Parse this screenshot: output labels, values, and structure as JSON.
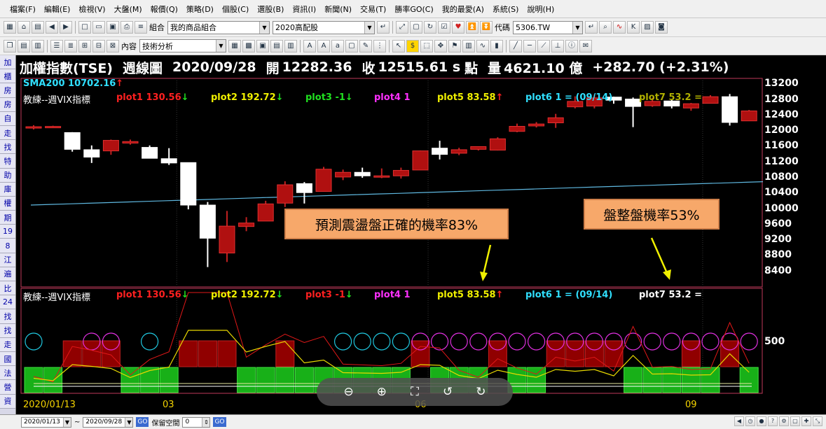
{
  "menu": [
    "檔案(F)",
    "編輯(E)",
    "檢視(V)",
    "大盤(M)",
    "報價(Q)",
    "策略(D)",
    "個股(C)",
    "選股(B)",
    "資訊(I)",
    "新聞(N)",
    "交易(T)",
    "勝率GO(C)",
    "我的最愛(A)",
    "系統(S)",
    "說明(H)"
  ],
  "toolbar1": {
    "group_label": "組合",
    "portfolio": "我的商品組合",
    "strategy": "2020高配股",
    "code_label": "代碼",
    "code_value": "5306.TW"
  },
  "toolbar2": {
    "content_label": "內容",
    "content_value": "技術分析"
  },
  "side_tabs": [
    "加",
    "櫃",
    "房",
    "房",
    "自",
    "走",
    "找",
    "特",
    "助",
    "庫",
    "權",
    "期",
    "19",
    "8",
    "江",
    "遍",
    "比",
    "24",
    "找",
    "找",
    "走",
    "國",
    "法",
    "營",
    "資"
  ],
  "title": {
    "name": "加權指數(TSE)",
    "period": "週線圖",
    "date": "2020/09/28",
    "open_label": "開",
    "open": "12282.36",
    "close_label": "收",
    "close": "12515.61 s",
    "unit": "點",
    "volume_label": "量",
    "volume": "4621.10 億",
    "change": "+282.70 (+2.31%)"
  },
  "main_panel": {
    "sma_label": "SMA200 10702.16",
    "sma_arrow": "↑",
    "indicator_name": "教練--週VIX指標",
    "plots": [
      {
        "label": "plot1 130.56",
        "arrow": "↓",
        "color": "#ff2020"
      },
      {
        "label": "plot2 192.72",
        "arrow": "↓",
        "color": "#f0f000"
      },
      {
        "label": "plot3 -1",
        "arrow": "↓",
        "color": "#20e020"
      },
      {
        "label": "plot4 1",
        "arrow": "",
        "color": "#ff30ff"
      },
      {
        "label": "plot5 83.58",
        "arrow": "↑",
        "color": "#f0f000"
      },
      {
        "label": "plot6 1 = (09/14)",
        "arrow": "",
        "color": "#30e0ff"
      },
      {
        "label": "plot7 53.2 =",
        "arrow": "",
        "color": "#b0b000"
      }
    ]
  },
  "sub_panel": {
    "indicator_name": "教練--週VIX指標",
    "plots": [
      {
        "label": "plot1 130.56",
        "arrow": "↓",
        "color": "#ff2020"
      },
      {
        "label": "plot2 192.72",
        "arrow": "↓",
        "color": "#f0f000"
      },
      {
        "label": "plot3 -1",
        "arrow": "↓",
        "color": "#ff2020"
      },
      {
        "label": "plot4 1",
        "arrow": "",
        "color": "#ff30ff"
      },
      {
        "label": "plot5 83.58",
        "arrow": "↑",
        "color": "#f0f000"
      },
      {
        "label": "plot6 1 = (09/14)",
        "arrow": "",
        "color": "#30e0ff"
      },
      {
        "label": "plot7 53.2 =",
        "arrow": "",
        "color": "#ffffff"
      }
    ],
    "y_label": "500"
  },
  "callouts": {
    "volatile": "預測震盪盤正確的機率83%",
    "consolidation": "盤整盤機率53%"
  },
  "statusbar": {
    "start_date": "2020/01/13",
    "end_date": "2020/09/28",
    "go_label": "GO",
    "reserve_label": "保留空間",
    "reserve_value": "0",
    "tilde": "~"
  },
  "chart_data": {
    "type": "candlestick",
    "y_ticks": [
      13200,
      12800,
      12400,
      12000,
      11600,
      11200,
      10800,
      10400,
      10000,
      9600,
      9200,
      8800,
      8400
    ],
    "ylim": [
      8000,
      13350
    ],
    "x_ticks": [
      "2020/01/13",
      "03",
      "06",
      "09"
    ],
    "candles": [
      {
        "o": 12090,
        "h": 12150,
        "l": 12040,
        "c": 12110
      },
      {
        "o": 12118,
        "h": 12135,
        "l": 12095,
        "c": 12118
      },
      {
        "o": 11960,
        "h": 11970,
        "l": 11470,
        "c": 11530
      },
      {
        "o": 11520,
        "h": 11630,
        "l": 11180,
        "c": 11330
      },
      {
        "o": 11490,
        "h": 11780,
        "l": 11390,
        "c": 11760
      },
      {
        "o": 11690,
        "h": 11780,
        "l": 11650,
        "c": 11730
      },
      {
        "o": 11580,
        "h": 11630,
        "l": 11300,
        "c": 11300
      },
      {
        "o": 11290,
        "h": 11560,
        "l": 11130,
        "c": 11180
      },
      {
        "o": 11190,
        "h": 11190,
        "l": 9990,
        "c": 10100
      },
      {
        "o": 10100,
        "h": 10180,
        "l": 8510,
        "c": 9250
      },
      {
        "o": 8870,
        "h": 9950,
        "l": 8640,
        "c": 9560
      },
      {
        "o": 9550,
        "h": 9790,
        "l": 9430,
        "c": 9640
      },
      {
        "o": 9690,
        "h": 10210,
        "l": 9690,
        "c": 10130
      },
      {
        "o": 10150,
        "h": 10710,
        "l": 10050,
        "c": 10620
      },
      {
        "o": 10650,
        "h": 10690,
        "l": 10140,
        "c": 10420
      },
      {
        "o": 10450,
        "h": 11080,
        "l": 10450,
        "c": 11020
      },
      {
        "o": 10820,
        "h": 11010,
        "l": 10740,
        "c": 10940
      },
      {
        "o": 10940,
        "h": 11060,
        "l": 10800,
        "c": 10850
      },
      {
        "o": 10820,
        "h": 11040,
        "l": 10790,
        "c": 10850
      },
      {
        "o": 10850,
        "h": 11060,
        "l": 10780,
        "c": 10990
      },
      {
        "o": 11000,
        "h": 11500,
        "l": 11000,
        "c": 11490
      },
      {
        "o": 11560,
        "h": 11750,
        "l": 11270,
        "c": 11400
      },
      {
        "o": 11430,
        "h": 11570,
        "l": 11380,
        "c": 11520
      },
      {
        "o": 11530,
        "h": 11600,
        "l": 11500,
        "c": 11600
      },
      {
        "o": 11510,
        "h": 11840,
        "l": 11500,
        "c": 11800
      },
      {
        "o": 11990,
        "h": 12190,
        "l": 11970,
        "c": 12120
      },
      {
        "o": 12130,
        "h": 12230,
        "l": 12090,
        "c": 12180
      },
      {
        "o": 12210,
        "h": 12440,
        "l": 12080,
        "c": 12340
      },
      {
        "o": 12620,
        "h": 12890,
        "l": 12580,
        "c": 12760
      },
      {
        "o": 12640,
        "h": 12940,
        "l": 12580,
        "c": 12850
      },
      {
        "o": 12870,
        "h": 12880,
        "l": 12700,
        "c": 12790
      },
      {
        "o": 12820,
        "h": 12860,
        "l": 12100,
        "c": 12630
      },
      {
        "o": 12650,
        "h": 12850,
        "l": 12620,
        "c": 12760
      },
      {
        "o": 12770,
        "h": 12820,
        "l": 12580,
        "c": 12640
      },
      {
        "o": 12590,
        "h": 12720,
        "l": 12520,
        "c": 12700
      },
      {
        "o": 12710,
        "h": 12920,
        "l": 12710,
        "c": 12880
      },
      {
        "o": 12880,
        "h": 12950,
        "l": 12140,
        "c": 12220
      },
      {
        "o": 12260,
        "h": 12540,
        "l": 12260,
        "c": 12515
      }
    ],
    "sma200": {
      "start": 10100,
      "end": 10702.16
    },
    "sub": {
      "red_boxes": [
        2,
        3,
        4,
        8,
        9,
        10,
        13,
        20,
        24,
        27,
        28,
        29,
        30,
        34,
        36
      ],
      "magenta_circles": [
        3,
        4,
        20,
        21,
        22,
        23,
        24,
        25,
        26,
        27,
        28,
        29,
        30,
        31,
        32,
        33,
        34,
        35,
        36,
        37
      ],
      "cyan_circles": [
        0,
        6,
        16,
        17,
        18,
        19
      ],
      "green_bars": [
        0,
        1,
        5,
        6,
        7,
        11,
        12,
        13,
        14,
        15,
        16,
        17,
        18,
        19,
        21,
        22,
        23,
        25,
        26,
        31,
        32,
        33,
        34,
        35,
        37
      ]
    }
  }
}
